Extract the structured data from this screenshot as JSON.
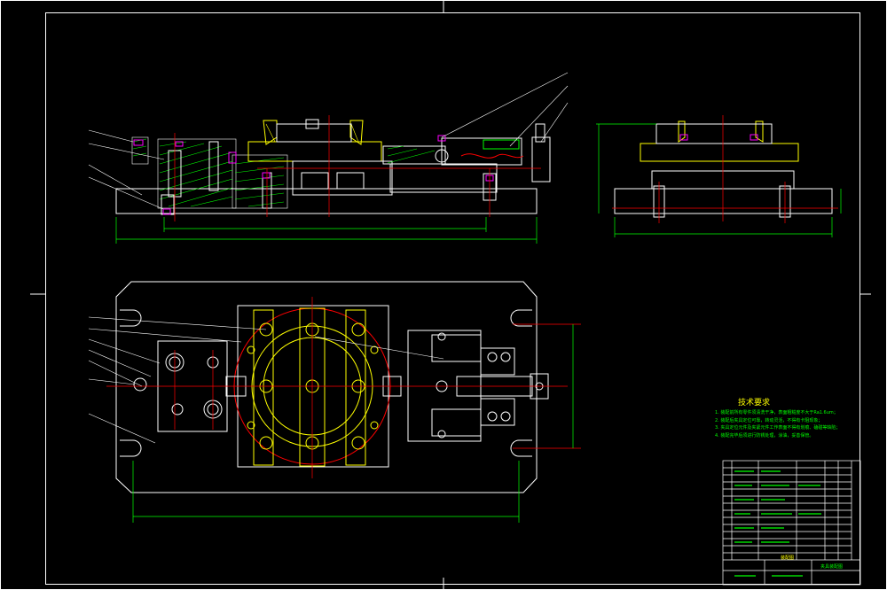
{
  "drawing": {
    "background_color": "#000000",
    "line_color": "#ffffff",
    "centerline_color": "#ff0000",
    "part_color": "#00ff00",
    "fixture_color": "#ffff00",
    "hatch_color": "#00ff00",
    "bolt_color": "#ff00ff",
    "dimension_color": "#00ff00"
  },
  "technical_requirements": {
    "title": "技术要求",
    "items": [
      "1. 装配前所有零件须清洗干净，表面粗糙度不大于Ra1.6um；",
      "2. 装配后夹具定位可靠，转动灵活，不得有卡阻现象；",
      "3. 夹具定位元件及夹紧元件工作表面不得有划痕、磕碰等缺陷；",
      "4. 装配完毕后须进行防锈处理，涂油，妥善保管。"
    ]
  },
  "title_block": {
    "drawing_name": "装配图",
    "drawing_no": "夹具装配图"
  }
}
